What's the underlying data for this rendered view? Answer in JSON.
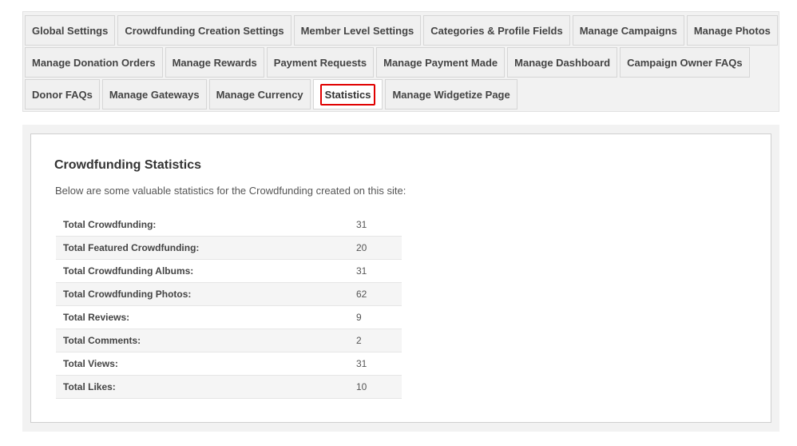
{
  "tabs": {
    "row1": [
      {
        "label": "Global Settings"
      },
      {
        "label": "Crowdfunding Creation Settings"
      },
      {
        "label": "Member Level Settings"
      },
      {
        "label": "Categories & Profile Fields"
      },
      {
        "label": "Manage Campaigns"
      },
      {
        "label": "Manage Photos"
      }
    ],
    "row2": [
      {
        "label": "Manage Donation Orders"
      },
      {
        "label": "Manage Rewards"
      },
      {
        "label": "Payment Requests"
      },
      {
        "label": "Manage Payment Made"
      },
      {
        "label": "Manage Dashboard"
      },
      {
        "label": "Campaign Owner FAQs"
      }
    ],
    "row3": [
      {
        "label": "Donor FAQs"
      },
      {
        "label": "Manage Gateways"
      },
      {
        "label": "Manage Currency"
      },
      {
        "label": "Statistics",
        "active": true
      },
      {
        "label": "Manage Widgetize Page"
      }
    ],
    "highlight_color": "#e00000"
  },
  "main": {
    "title": "Crowdfunding Statistics",
    "description": "Below are some valuable statistics for the Crowdfunding created on this site:",
    "stats": [
      {
        "label": "Total Crowdfunding:",
        "value": "31"
      },
      {
        "label": "Total Featured Crowdfunding:",
        "value": "20"
      },
      {
        "label": "Total Crowdfunding Albums:",
        "value": "31"
      },
      {
        "label": "Total Crowdfunding Photos:",
        "value": "62"
      },
      {
        "label": "Total Reviews:",
        "value": "9"
      },
      {
        "label": "Total Comments:",
        "value": "2"
      },
      {
        "label": "Total Views:",
        "value": "31"
      },
      {
        "label": "Total Likes:",
        "value": "10"
      }
    ]
  }
}
